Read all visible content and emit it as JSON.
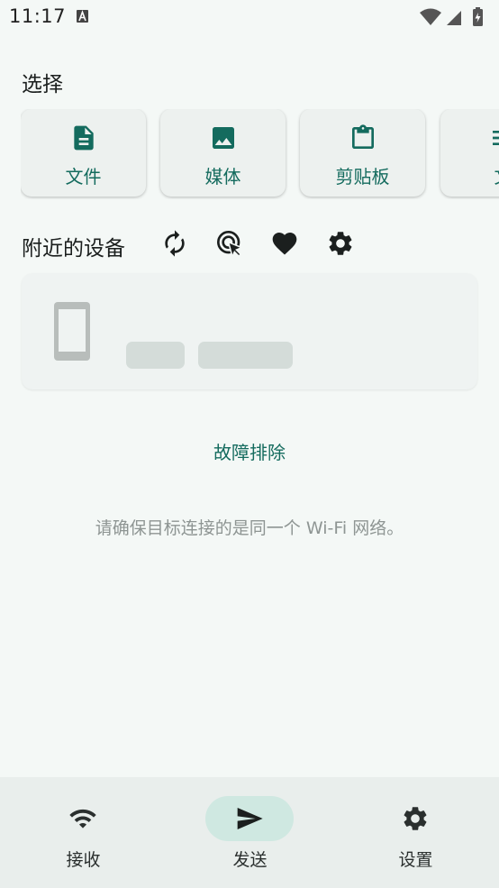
{
  "status_bar": {
    "time": "11:17"
  },
  "select_section": {
    "title": "选择",
    "cards": [
      {
        "label": "文件",
        "icon": "file-icon"
      },
      {
        "label": "媒体",
        "icon": "image-icon"
      },
      {
        "label": "剪贴板",
        "icon": "clipboard-icon"
      },
      {
        "label": "文",
        "icon": "text-icon"
      }
    ]
  },
  "nearby_section": {
    "title": "附近的设备",
    "actions": [
      "refresh-icon",
      "target-cursor-icon",
      "heart-icon",
      "gear-icon"
    ]
  },
  "troubleshoot_label": "故障排除",
  "hint_text": "请确保目标连接的是同一个 Wi-Fi 网络。",
  "bottom_nav": {
    "items": [
      {
        "label": "接收",
        "icon": "wifi-icon"
      },
      {
        "label": "发送",
        "icon": "send-icon",
        "active": true
      },
      {
        "label": "设置",
        "icon": "gear-icon"
      }
    ]
  },
  "colors": {
    "background": "#f4f8f6",
    "accent": "#146b5e",
    "active_pill": "#cfe8e1",
    "nav_background": "#e9eeec",
    "card_background": "#edf1ef"
  }
}
